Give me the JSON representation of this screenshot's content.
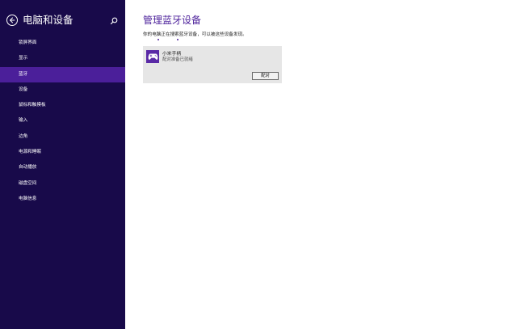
{
  "header": {
    "title": "电脑和设备"
  },
  "nav": {
    "items": [
      {
        "label": "锁屏界面"
      },
      {
        "label": "显示"
      },
      {
        "label": "蓝牙"
      },
      {
        "label": "设备"
      },
      {
        "label": "鼠标和触摸板"
      },
      {
        "label": "输入"
      },
      {
        "label": "边角"
      },
      {
        "label": "电源和睡眠"
      },
      {
        "label": "自动播放"
      },
      {
        "label": "磁盘空间"
      },
      {
        "label": "电脑信息"
      }
    ],
    "active_index": 2
  },
  "main": {
    "title": "管理蓝牙设备",
    "status_text": "你的电脑正在搜索蓝牙设备，可以被这些设备发现。",
    "device": {
      "name": "小米手柄",
      "status": "配对准备已就绪",
      "icon": "gamepad-icon",
      "pair_label": "配对"
    }
  },
  "colors": {
    "sidebar_bg": "#180a4a",
    "active_item": "#4b1f9a",
    "accent": "#4b1f9a",
    "card_bg": "#e6e6e6"
  }
}
